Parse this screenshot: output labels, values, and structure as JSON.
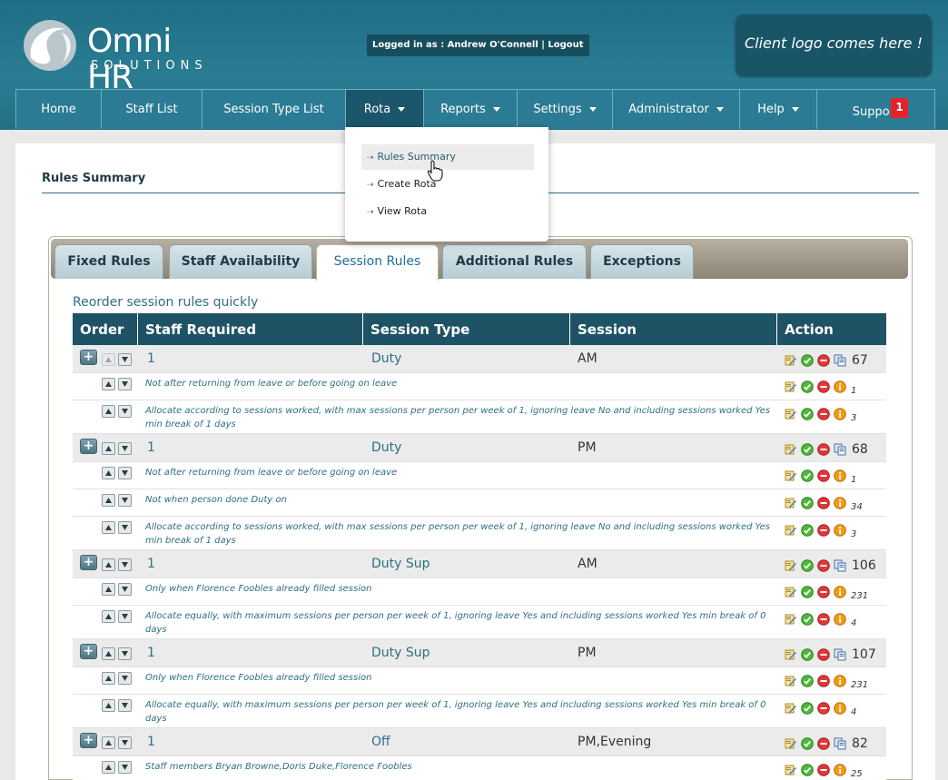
{
  "header": {
    "logo_name": "Omni HR",
    "logo_sub": "SOLUTIONS",
    "login_text": "Logged in as : Andrew O'Connell | Logout",
    "client_logo_text": "Client logo comes here !"
  },
  "nav": {
    "items": [
      {
        "label": "Home"
      },
      {
        "label": "Staff List"
      },
      {
        "label": "Session Type List"
      },
      {
        "label": "Rota"
      },
      {
        "label": "Reports"
      },
      {
        "label": "Settings"
      },
      {
        "label": "Administrator"
      },
      {
        "label": "Help"
      },
      {
        "label": "Support"
      }
    ],
    "support_badge": "1"
  },
  "dropdown": {
    "items": [
      {
        "label": "Rules Summary"
      },
      {
        "label": "Create Rota"
      },
      {
        "label": "View Rota"
      }
    ]
  },
  "page": {
    "title": "Rules Summary",
    "reorder_link": "Reorder session rules quickly"
  },
  "tabs": [
    {
      "label": "Fixed Rules"
    },
    {
      "label": "Staff Availability"
    },
    {
      "label": "Session Rules"
    },
    {
      "label": "Additional Rules"
    },
    {
      "label": "Exceptions"
    }
  ],
  "table": {
    "headers": [
      "Order",
      "Staff Required",
      "Session Type",
      "Session",
      "Action"
    ],
    "groups": [
      {
        "staff": "1",
        "type": "Duty",
        "session": "AM",
        "count": "67",
        "subs": [
          {
            "text": "Not after returning from leave or before going on leave",
            "count": "1"
          },
          {
            "text": "Allocate according to sessions worked, with max sessions per person per week of 1, ignoring leave No and including sessions worked Yes min break of 1 days",
            "count": "3"
          }
        ]
      },
      {
        "staff": "1",
        "type": "Duty",
        "session": "PM",
        "count": "68",
        "subs": [
          {
            "text": "Not after returning from leave or before going on leave",
            "count": "1"
          },
          {
            "text": "Not when person done Duty on",
            "count": "34"
          },
          {
            "text": "Allocate according to sessions worked, with max sessions per person per week of 1, ignoring leave No and including sessions worked Yes min break of 1 days",
            "count": "3"
          }
        ]
      },
      {
        "staff": "1",
        "type": "Duty Sup",
        "session": "AM",
        "count": "106",
        "subs": [
          {
            "text": "Only when Florence Foobles already filled session",
            "count": "231"
          },
          {
            "text": "Allocate equally, with maximum sessions per person per week of 1, ignoring leave Yes and including sessions worked Yes min break of 0 days",
            "count": "4"
          }
        ]
      },
      {
        "staff": "1",
        "type": "Duty Sup",
        "session": "PM",
        "count": "107",
        "subs": [
          {
            "text": "Only when Florence Foobles already filled session",
            "count": "231"
          },
          {
            "text": "Allocate equally, with maximum sessions per person per week of 1, ignoring leave Yes and including sessions worked Yes min break of 0 days",
            "count": "4"
          }
        ]
      },
      {
        "staff": "1",
        "type": "Off",
        "session": "PM,Evening",
        "count": "82",
        "subs": [
          {
            "text": "Staff members Bryan Browne,Doris Duke,Florence Foobles",
            "count": "25"
          }
        ]
      }
    ]
  },
  "colors": {
    "header_bg": "#1f6e86",
    "nav_active": "#1b566a",
    "table_header": "#1e5365",
    "link_text": "#2f6f83",
    "badge": "#e62227"
  }
}
